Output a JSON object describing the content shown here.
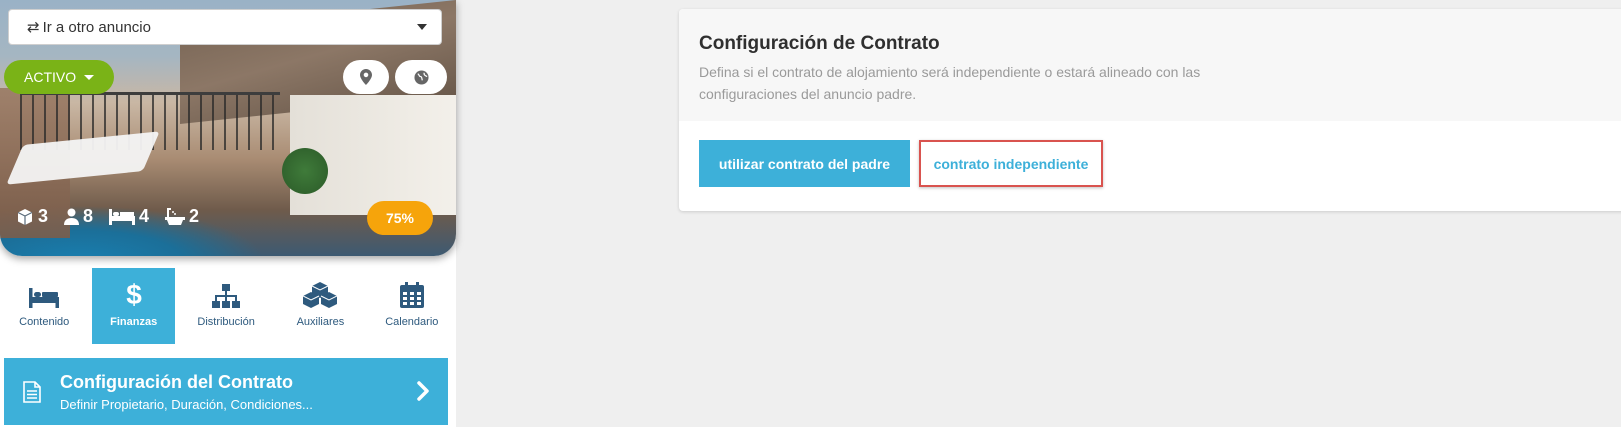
{
  "listing_switcher": {
    "label": "Ir a otro anuncio"
  },
  "hero": {
    "status_label": "ACTIVO",
    "stats": {
      "rooms": "3",
      "guests": "8",
      "beds": "4",
      "baths": "2"
    },
    "completion": "75%"
  },
  "tabs": [
    {
      "label": "Contenido",
      "icon": "bed-icon"
    },
    {
      "label": "Finanzas",
      "icon": "dollar-icon"
    },
    {
      "label": "Distribución",
      "icon": "sitemap-icon"
    },
    {
      "label": "Auxiliares",
      "icon": "cubes-icon"
    },
    {
      "label": "Calendario",
      "icon": "calendar-icon"
    }
  ],
  "contract_card": {
    "title": "Configuración del Contrato",
    "subtitle": "Definir Propietario, Duración, Condiciones..."
  },
  "panel": {
    "title": "Configuración de Contrato",
    "description": "Defina si el contrato de alojamiento será independiente o estará alineado con las configuraciones del anuncio padre.",
    "primary_button": "utilizar contrato del padre",
    "secondary_button": "contrato independiente"
  },
  "colors": {
    "accent": "#3db0d9",
    "status_green": "#7ab317",
    "progress_orange": "#f6a40b",
    "highlight_red": "#d9534f"
  }
}
